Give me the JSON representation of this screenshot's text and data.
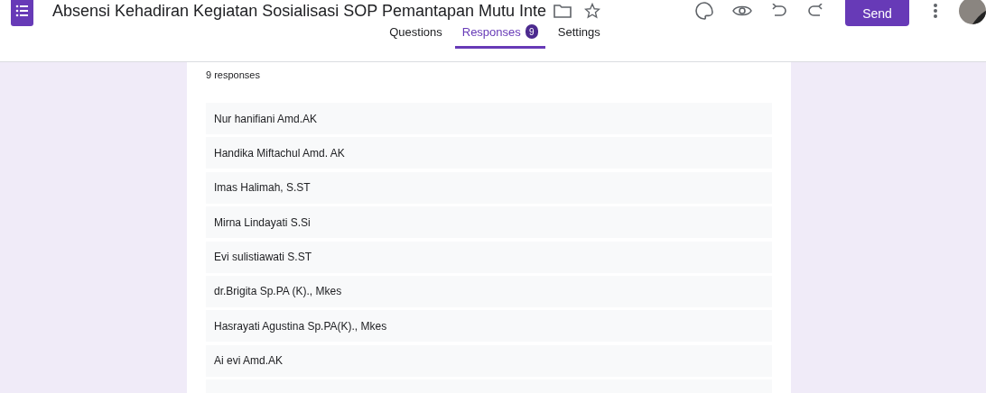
{
  "header": {
    "title": "Absensi Kehadiran Kegiatan Sosialisasi SOP Pemantapan Mutu Inte",
    "send_label": "Send"
  },
  "tabs": [
    {
      "label": "Questions",
      "selected": false
    },
    {
      "label": "Responses",
      "selected": true,
      "badge": "9"
    },
    {
      "label": "Settings",
      "selected": false
    }
  ],
  "summary": "9 responses",
  "responses": [
    "Nur hanifiani Amd.AK",
    "Handika Miftachul Amd. AK",
    "Imas Halimah, S.ST",
    "Mirna Lindayati S.Si",
    "Evi sulistiawati S.ST",
    "dr.Brigita Sp.PA (K)., Mkes",
    "Hasrayati Agustina Sp.PA(K)., Mkes",
    "Ai evi Amd.AK"
  ]
}
